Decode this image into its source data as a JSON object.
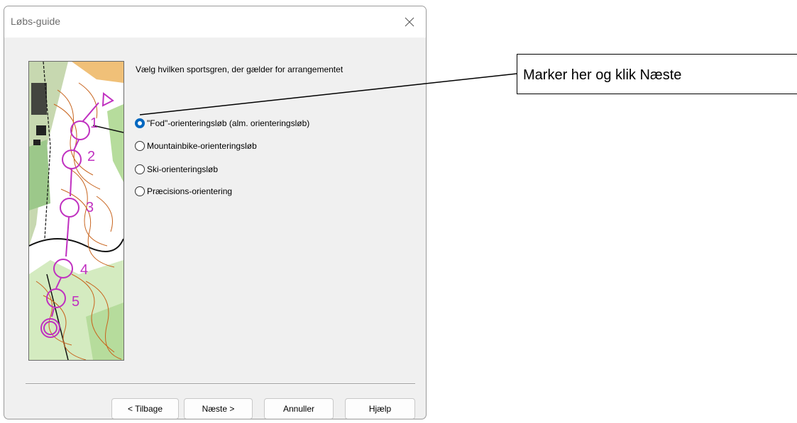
{
  "dialog": {
    "title": "Løbs-guide",
    "prompt": "Vælg hvilken sportsgren, der gælder for arrangementet",
    "options": [
      {
        "label": "\"Fod\"-orienteringsløb  (alm. orienteringsløb)",
        "selected": true
      },
      {
        "label": "Mountainbike-orienteringsløb",
        "selected": false
      },
      {
        "label": "Ski-orienteringsløb",
        "selected": false
      },
      {
        "label": "Præcisions-orientering",
        "selected": false
      }
    ],
    "buttons": {
      "back": "< Tilbage",
      "next": "Næste >",
      "cancel": "Annuller",
      "help": "Hjælp"
    },
    "map_control_numbers": [
      "1",
      "2",
      "3",
      "4",
      "5"
    ]
  },
  "callout": {
    "text": "Marker her og klik Næste"
  },
  "colors": {
    "accent": "#0067c0",
    "dialog_bg": "#f0f0f0",
    "map_course": "#c030c0",
    "map_contour": "#c8641e",
    "map_vegetation": "#b6dc9c"
  },
  "icons": {
    "close": "close-icon",
    "radio": "radio-button"
  }
}
